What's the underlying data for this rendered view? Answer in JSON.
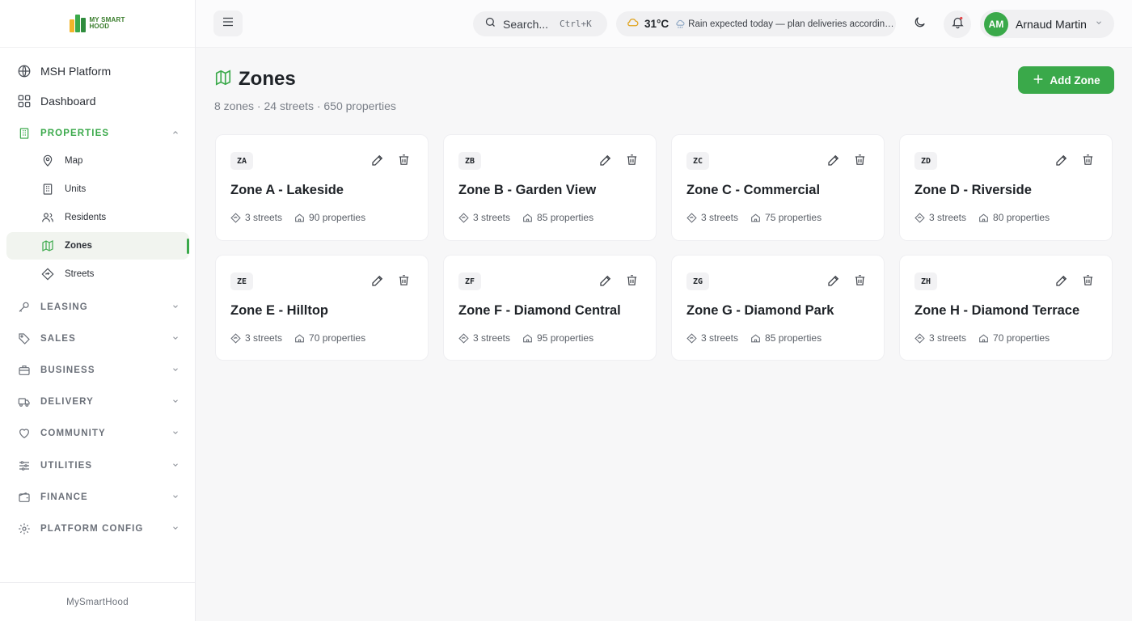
{
  "brand": {
    "logo_line1": "MY SMART",
    "logo_line2": "HOOD",
    "footer": "MySmartHood"
  },
  "sidebar": {
    "items": [
      {
        "label": "MSH Platform",
        "icon": "globe-icon"
      },
      {
        "label": "Dashboard",
        "icon": "grid-icon"
      }
    ],
    "sections": [
      {
        "label": "PROPERTIES",
        "icon": "building-icon",
        "expanded": true
      },
      {
        "label": "LEASING",
        "icon": "key-icon"
      },
      {
        "label": "SALES",
        "icon": "tag-icon"
      },
      {
        "label": "BUSINESS",
        "icon": "briefcase-icon"
      },
      {
        "label": "DELIVERY",
        "icon": "truck-icon"
      },
      {
        "label": "COMMUNITY",
        "icon": "heart-icon"
      },
      {
        "label": "UTILITIES",
        "icon": "sliders-icon"
      },
      {
        "label": "FINANCE",
        "icon": "wallet-icon"
      },
      {
        "label": "PLATFORM CONFIG",
        "icon": "gear-icon"
      }
    ],
    "sub_items": [
      {
        "label": "Map",
        "icon": "map-pin-icon"
      },
      {
        "label": "Units",
        "icon": "building-icon"
      },
      {
        "label": "Residents",
        "icon": "users-icon"
      },
      {
        "label": "Zones",
        "icon": "map-icon",
        "active": true
      },
      {
        "label": "Streets",
        "icon": "signpost-icon"
      }
    ]
  },
  "topbar": {
    "search_placeholder": "Search...",
    "search_shortcut": "Ctrl+K",
    "weather_temp": "31°C",
    "weather_message": "Rain expected today — plan deliveries accordingly",
    "user_initials": "AM",
    "user_name": "Arnaud Martin"
  },
  "page": {
    "title": "Zones",
    "subtitle": "8 zones · 24 streets · 650 properties",
    "add_button": "Add Zone"
  },
  "zones": [
    {
      "code": "ZA",
      "name": "Zone A - Lakeside",
      "streets": "3 streets",
      "properties": "90 properties"
    },
    {
      "code": "ZB",
      "name": "Zone B - Garden View",
      "streets": "3 streets",
      "properties": "85 properties"
    },
    {
      "code": "ZC",
      "name": "Zone C - Commercial",
      "streets": "3 streets",
      "properties": "75 properties"
    },
    {
      "code": "ZD",
      "name": "Zone D - Riverside",
      "streets": "3 streets",
      "properties": "80 properties"
    },
    {
      "code": "ZE",
      "name": "Zone E - Hilltop",
      "streets": "3 streets",
      "properties": "70 properties"
    },
    {
      "code": "ZF",
      "name": "Zone F - Diamond Central",
      "streets": "3 streets",
      "properties": "95 properties"
    },
    {
      "code": "ZG",
      "name": "Zone G - Diamond Park",
      "streets": "3 streets",
      "properties": "85 properties"
    },
    {
      "code": "ZH",
      "name": "Zone H - Diamond Terrace",
      "streets": "3 streets",
      "properties": "70 properties"
    }
  ],
  "colors": {
    "accent": "#3aa94a",
    "background": "#f7f7f8"
  }
}
